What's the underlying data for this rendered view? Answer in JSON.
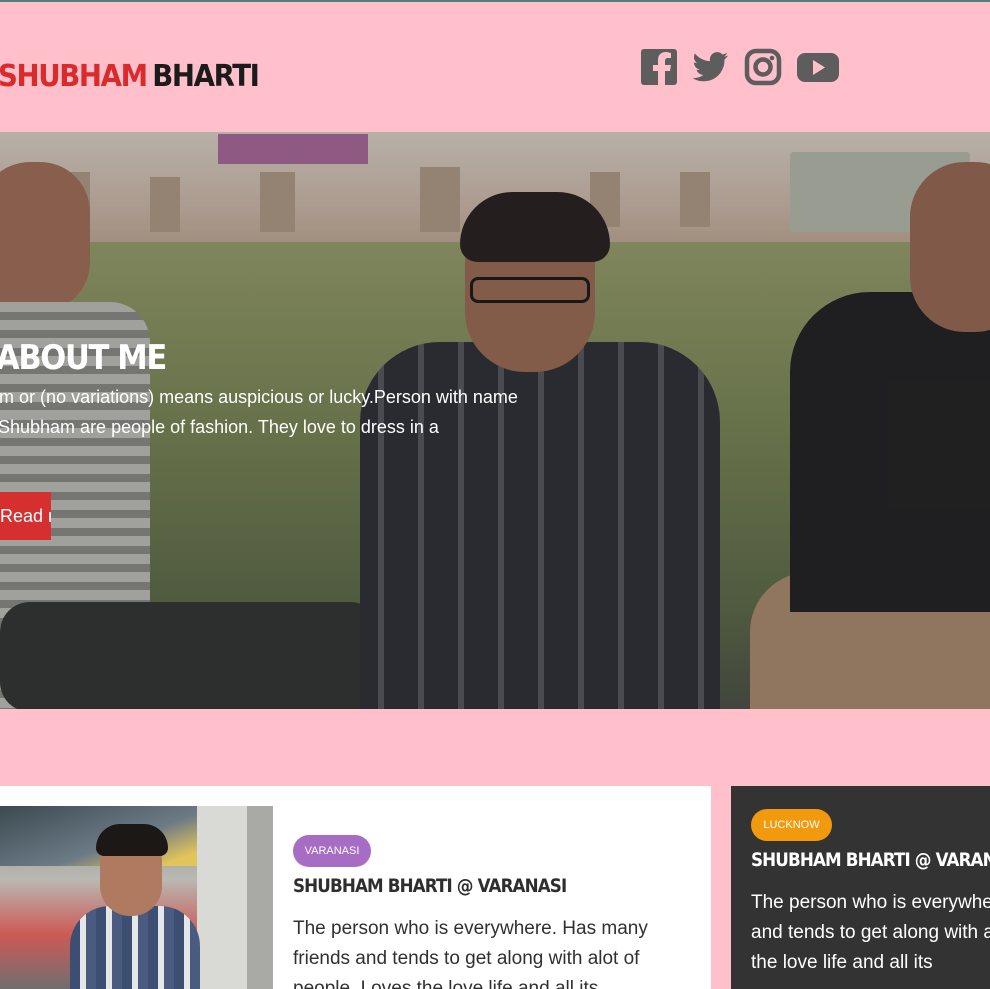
{
  "brand": {
    "part1": "SHUBHAM",
    "part2": "BHARTI",
    "accent": "#d92b2b"
  },
  "social": [
    {
      "name": "facebook-icon"
    },
    {
      "name": "twitter-icon"
    },
    {
      "name": "instagram-icon"
    },
    {
      "name": "youtube-icon"
    }
  ],
  "hero": {
    "title": "ABOUT ME",
    "text": "Shubham or (no variations) means auspicious or lucky.Person with name Shubham are people of fashion. They love to dress in a",
    "button_label": "Read more",
    "button_color": "#d62f2f"
  },
  "cards": [
    {
      "tag": "VARANASI",
      "tag_color": "#a76cc3",
      "title": "SHUBHAM BHARTI @ VARANASI",
      "text": "The person who is everywhere. Has many friends and tends to get along with alot of people. Loves the love life and all its"
    },
    {
      "tag": "LUCKNOW",
      "tag_color": "#f29a0e",
      "title": "SHUBHAM BHARTI @ VARANASI",
      "text": "The person who is everywhere. Has many friends and tends to get along with alot of people. Loves the love life and all its"
    }
  ],
  "colors": {
    "background": "#ffc0cb",
    "dark_card": "#333333"
  }
}
